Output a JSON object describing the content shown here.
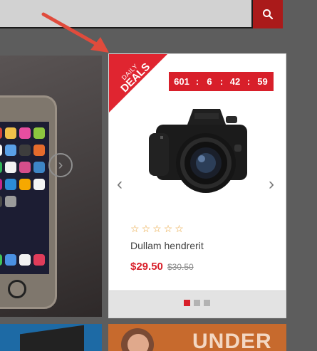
{
  "search": {
    "icon": "search-icon"
  },
  "deal": {
    "ribbon_small": "DAILY",
    "ribbon_big": "DEALS",
    "timer": [
      "601",
      "6",
      "42",
      "59"
    ],
    "product_name": "Dullam hendrerit",
    "price": "$29.50",
    "old_price": "$30.50",
    "rating": 0,
    "rating_max": 5,
    "pagination_total": 3,
    "pagination_active": 1
  },
  "promo": {
    "headline": "UNDER"
  },
  "colors": {
    "accent_red": "#d81f2a",
    "star_orange": "#e8a33a",
    "tile_blue": "#1d6aa5",
    "tile_orange": "#c76a2d"
  }
}
